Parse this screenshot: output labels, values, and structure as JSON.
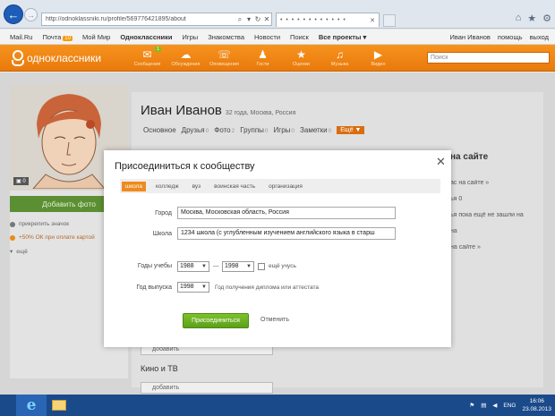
{
  "browser": {
    "url": "http://odnoklassniki.ru/profile/569776421895/about",
    "tab_title": "• • • • • • • • • • • •"
  },
  "mailru_bar": {
    "items": [
      "Mail.Ru",
      "Почта",
      "Мой Мир",
      "Одноклассники",
      "Игры",
      "Знакомства",
      "Новости",
      "Поиск",
      "Все проекты ▾"
    ],
    "mail_badge": "10",
    "user_name": "Иван Иванов",
    "help": "помощь",
    "logout": "выход"
  },
  "ok_header": {
    "logo_text": "одноклассники",
    "nav": [
      {
        "label": "Сообщения",
        "glyph": "✉",
        "badge": "1"
      },
      {
        "label": "Обсуждения",
        "glyph": "☁",
        "badge": ""
      },
      {
        "label": "Оповещения",
        "glyph": "☏",
        "badge": ""
      },
      {
        "label": "Гости",
        "glyph": "♟",
        "badge": ""
      },
      {
        "label": "Оценки",
        "glyph": "★",
        "badge": ""
      },
      {
        "label": "Музыка",
        "glyph": "♫",
        "badge": ""
      },
      {
        "label": "Видео",
        "glyph": "▶",
        "badge": ""
      }
    ],
    "search_placeholder": "Поиск"
  },
  "profile": {
    "name": "Иван Иванов",
    "meta": "32 года, Москва, Россия",
    "tabs": [
      {
        "label": "Основное",
        "count": ""
      },
      {
        "label": "Друзья",
        "count": "0"
      },
      {
        "label": "Фото",
        "count": "2"
      },
      {
        "label": "Группы",
        "count": "0"
      },
      {
        "label": "Игры",
        "count": "0"
      },
      {
        "label": "Заметки",
        "count": "0"
      }
    ],
    "more_label": "Ещё ▼",
    "photo_count": "0",
    "add_photo": "Добавить фото",
    "left_links": [
      "прикрепить значок",
      "+50% ОК при оплате картой",
      "ещё"
    ],
    "right_fragments": [
      "на сайте",
      "ас на сайте »",
      "ья 0",
      "ья пока ещё не зашли на",
      "на",
      "на сайте »"
    ],
    "section_label": "Кино и ТВ",
    "add_field": "добавить",
    "add_field_top": "добавить"
  },
  "modal": {
    "title": "Присоединиться к сообществу",
    "type_tabs": [
      "школа",
      "колледж",
      "вуз",
      "воинская часть",
      "организация"
    ],
    "active_tab": 0,
    "city_label": "Город",
    "city_value": "Москва, Московская область, Россия",
    "school_label": "Школа",
    "school_value": "1234 школа (с углубленным изучением английского языка в старш",
    "years_label": "Годы учебы",
    "year_from": "1988",
    "year_sep": "—",
    "year_to": "1998",
    "still_studying": "ещё учусь",
    "grad_label": "Год выпуска",
    "grad_year": "1998",
    "grad_hint": "Год получения диплома или аттестата",
    "join_button": "Присоединиться",
    "cancel_link": "Отменить"
  },
  "taskbar": {
    "lang": "ENG",
    "time": "16:06",
    "date": "23.08.2013"
  }
}
